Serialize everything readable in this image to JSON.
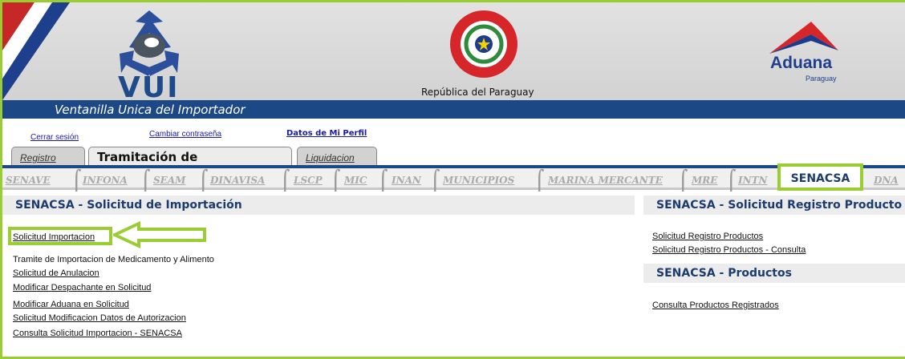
{
  "header": {
    "logo_text": "VUI",
    "country": "República del Paraguay",
    "aduana_name": "Aduana",
    "aduana_country": "Paraguay",
    "banner": "Ventanilla Unica del Importador"
  },
  "user_links": {
    "logout": "Cerrar sesión",
    "change_password": "Cambiar contraseña",
    "profile": "Datos de Mi Perfil"
  },
  "main_tabs": [
    "Registro",
    "Tramitación de Importación",
    "Liquidacion"
  ],
  "sub_tabs": [
    "SENAVE",
    "INFONA",
    "SEAM",
    "DINAVISA",
    "LSCP",
    "MIC",
    "INAN",
    "MUNICIPIOS",
    "MARINA MERCANTE",
    "MRE",
    "INTN",
    "SENACSA",
    "DNA"
  ],
  "left": {
    "title": "SENACSA - Solicitud de Importación",
    "items": [
      "Solicitud Importacion",
      "Tramite de Importacion de Medicamento y Alimento",
      "Solicitud de Anulacion",
      "Modificar Despachante en Solicitud",
      "Modificar Aduana en Solicitud",
      "Solicitud Modificacion Datos de Autorizacion",
      "Consulta Solicitud Importacion - SENACSA"
    ]
  },
  "right": {
    "title1": "SENACSA - Solicitud Registro Producto",
    "items1": [
      "Solicitud Registro Productos",
      "Solicitud Registro Productos - Consulta"
    ],
    "title2": "SENACSA - Productos",
    "items2": [
      "Consulta Productos Registrados"
    ]
  },
  "colors": {
    "highlight": "#9acd32",
    "brand_blue": "#1c4886"
  }
}
